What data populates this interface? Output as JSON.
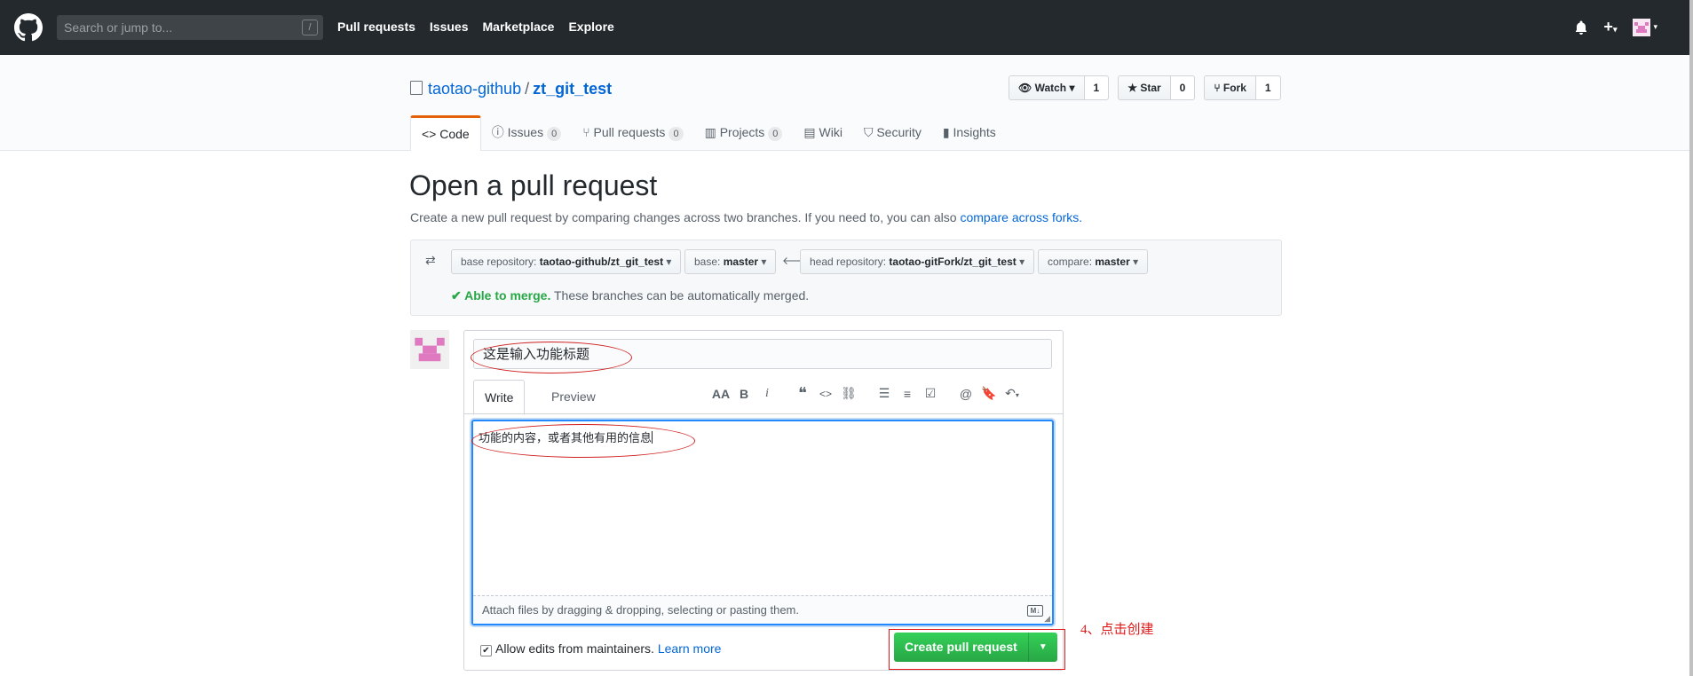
{
  "header": {
    "search_placeholder": "Search or jump to...",
    "search_shortcut": "/",
    "nav": [
      "Pull requests",
      "Issues",
      "Marketplace",
      "Explore"
    ]
  },
  "repo": {
    "owner": "taotao-github",
    "separator": "/",
    "name": "zt_git_test",
    "watch_label": "Watch",
    "watch_count": "1",
    "star_label": "Star",
    "star_count": "0",
    "fork_label": "Fork",
    "fork_count": "1",
    "tabs": [
      {
        "label": "Code",
        "count": ""
      },
      {
        "label": "Issues",
        "count": "0"
      },
      {
        "label": "Pull requests",
        "count": "0"
      },
      {
        "label": "Projects",
        "count": "0"
      },
      {
        "label": "Wiki",
        "count": ""
      },
      {
        "label": "Security",
        "count": ""
      },
      {
        "label": "Insights",
        "count": ""
      }
    ]
  },
  "page": {
    "title": "Open a pull request",
    "subtitle": "Create a new pull request by comparing changes across two branches. If you need to, you can also",
    "subtitle_link": "compare across forks."
  },
  "compare": {
    "base_repo_label": "base repository:",
    "base_repo": "taotao-github/zt_git_test",
    "base_label": "base:",
    "base": "master",
    "head_repo_label": "head repository:",
    "head_repo": "taotao-gitFork/zt_git_test",
    "compare_label": "compare:",
    "compare": "master",
    "merge_status": "Able to merge.",
    "merge_detail": "These branches can be automatically merged."
  },
  "form": {
    "title_value": "这是输入功能标题",
    "write_tab": "Write",
    "preview_tab": "Preview",
    "body_value": "功能的内容，或者其他有用的信息",
    "attach_text": "Attach files by dragging & dropping, selecting or pasting them.",
    "allow_label": "Allow edits from maintainers.",
    "learn_more": "Learn more",
    "create_button": "Create pull request"
  },
  "annotation": {
    "text": "4、点击创建"
  },
  "colors": {
    "header_bg": "#24292e",
    "link": "#0366d6",
    "success": "#28a745",
    "annotation_red": "#e01818"
  }
}
